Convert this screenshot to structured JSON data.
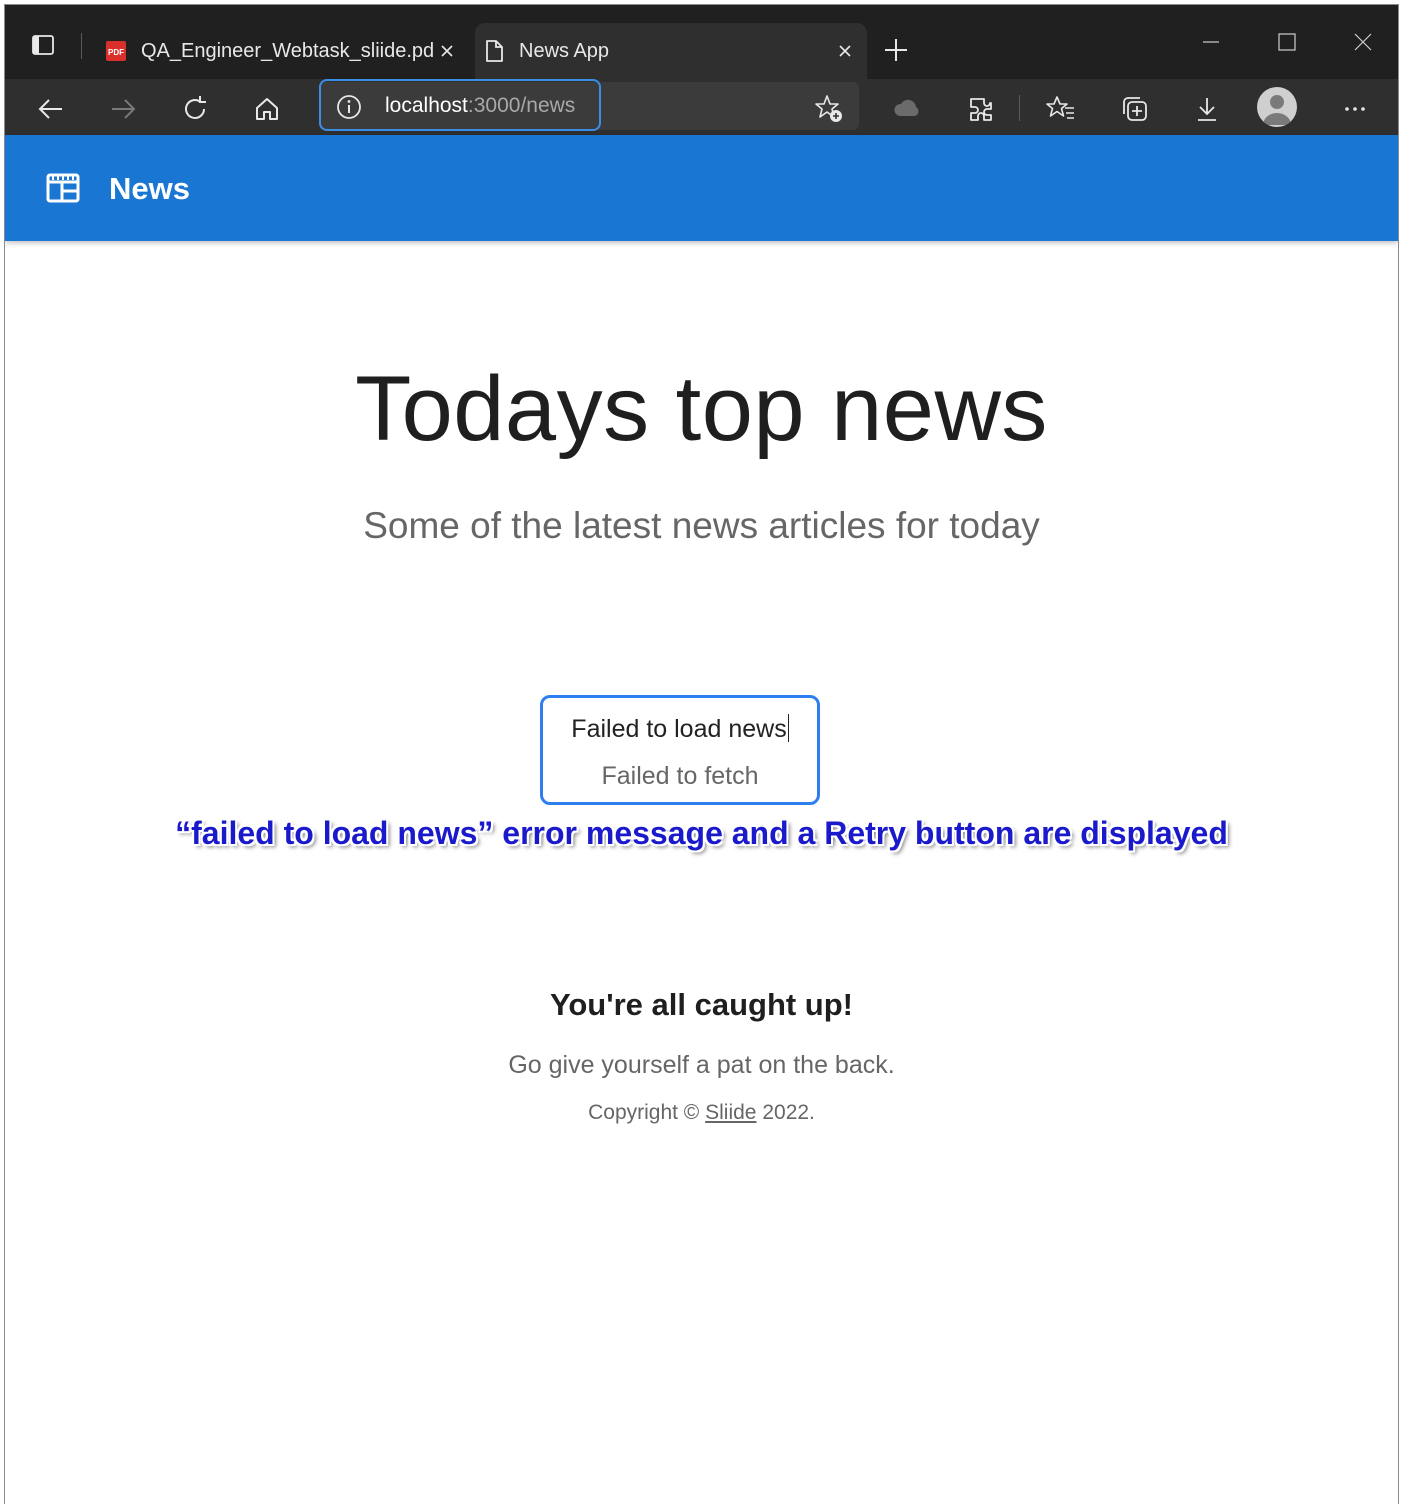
{
  "browser": {
    "tabs": [
      {
        "title": "QA_Engineer_Webtask_sliide.pdf",
        "icon": "pdf-icon",
        "active": false
      },
      {
        "title": "News App",
        "icon": "page-icon",
        "active": true
      }
    ],
    "address": {
      "host": "localhost",
      "path": ":3000/news"
    }
  },
  "appbar": {
    "title": "News",
    "icon": "newspaper-icon"
  },
  "hero": {
    "title": "Todays top news",
    "subtitle": "Some of the latest news articles for today"
  },
  "error": {
    "title": "Failed to load news",
    "retry_label": "Failed to fetch"
  },
  "annotation": "“failed to load news” error message and a Retry button are displayed",
  "footer": {
    "caught_up": "You're all caught up!",
    "message": "Go give yourself a pat on the back.",
    "copyright_prefix": "Copyright ©",
    "copyright_link": "Sliide",
    "copyright_suffix": "2022."
  },
  "colors": {
    "appbar": "#1976d2",
    "error_border": "#2f7ef0",
    "annotation": "#1a1acc",
    "chrome_dark": "#202020"
  }
}
